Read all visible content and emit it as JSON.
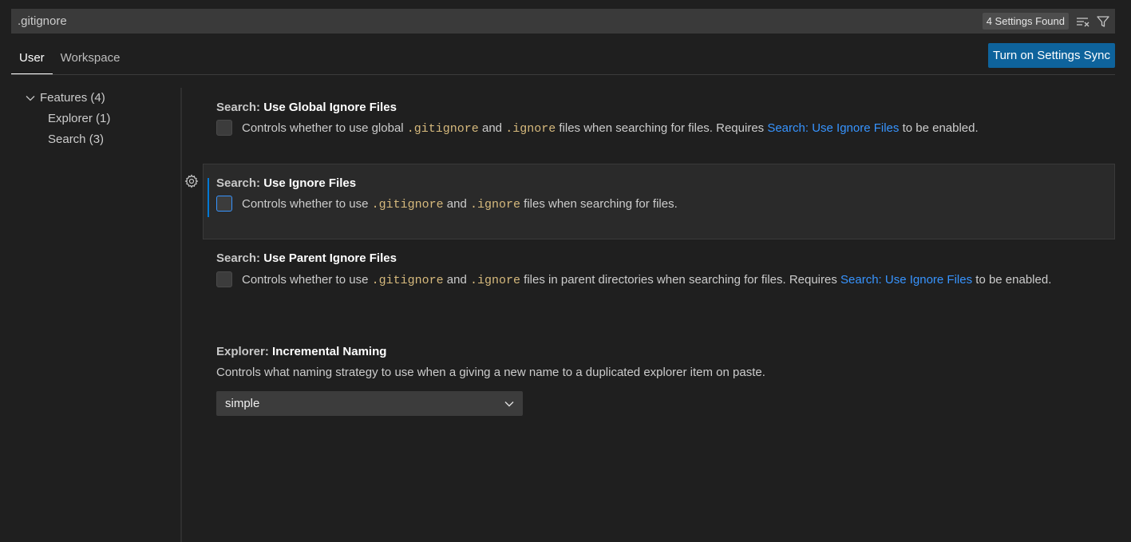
{
  "search": {
    "value": ".gitignore",
    "results_badge": "4 Settings Found"
  },
  "tabs": [
    {
      "label": "User"
    },
    {
      "label": "Workspace"
    }
  ],
  "sync_button": "Turn on Settings Sync",
  "toc": {
    "features": "Features (4)",
    "explorer": "Explorer (1)",
    "search": "Search (3)"
  },
  "settings": [
    {
      "category": "Search: ",
      "name": "Use Global Ignore Files",
      "desc": {
        "t1": "Controls whether to use global ",
        "c1": ".gitignore",
        "t2": " and ",
        "c2": ".ignore",
        "t3": " files when searching for files. Requires ",
        "link": "Search: Use Ignore Files",
        "t4": " to be enabled."
      }
    },
    {
      "category": "Search: ",
      "name": "Use Ignore Files",
      "desc": {
        "t1": "Controls whether to use ",
        "c1": ".gitignore",
        "t2": " and ",
        "c2": ".ignore",
        "t3": " files when searching for files."
      }
    },
    {
      "category": "Search: ",
      "name": "Use Parent Ignore Files",
      "desc": {
        "t1": "Controls whether to use ",
        "c1": ".gitignore",
        "t2": " and ",
        "c2": ".ignore",
        "t3": " files in parent directories when searching for files. Requires ",
        "link": "Search: Use Ignore Files",
        "t4": " to be enabled."
      }
    },
    {
      "category": "Explorer: ",
      "name": "Incremental Naming",
      "desc": "Controls what naming strategy to use when a giving a new name to a duplicated explorer item on paste.",
      "value": "simple"
    }
  ]
}
